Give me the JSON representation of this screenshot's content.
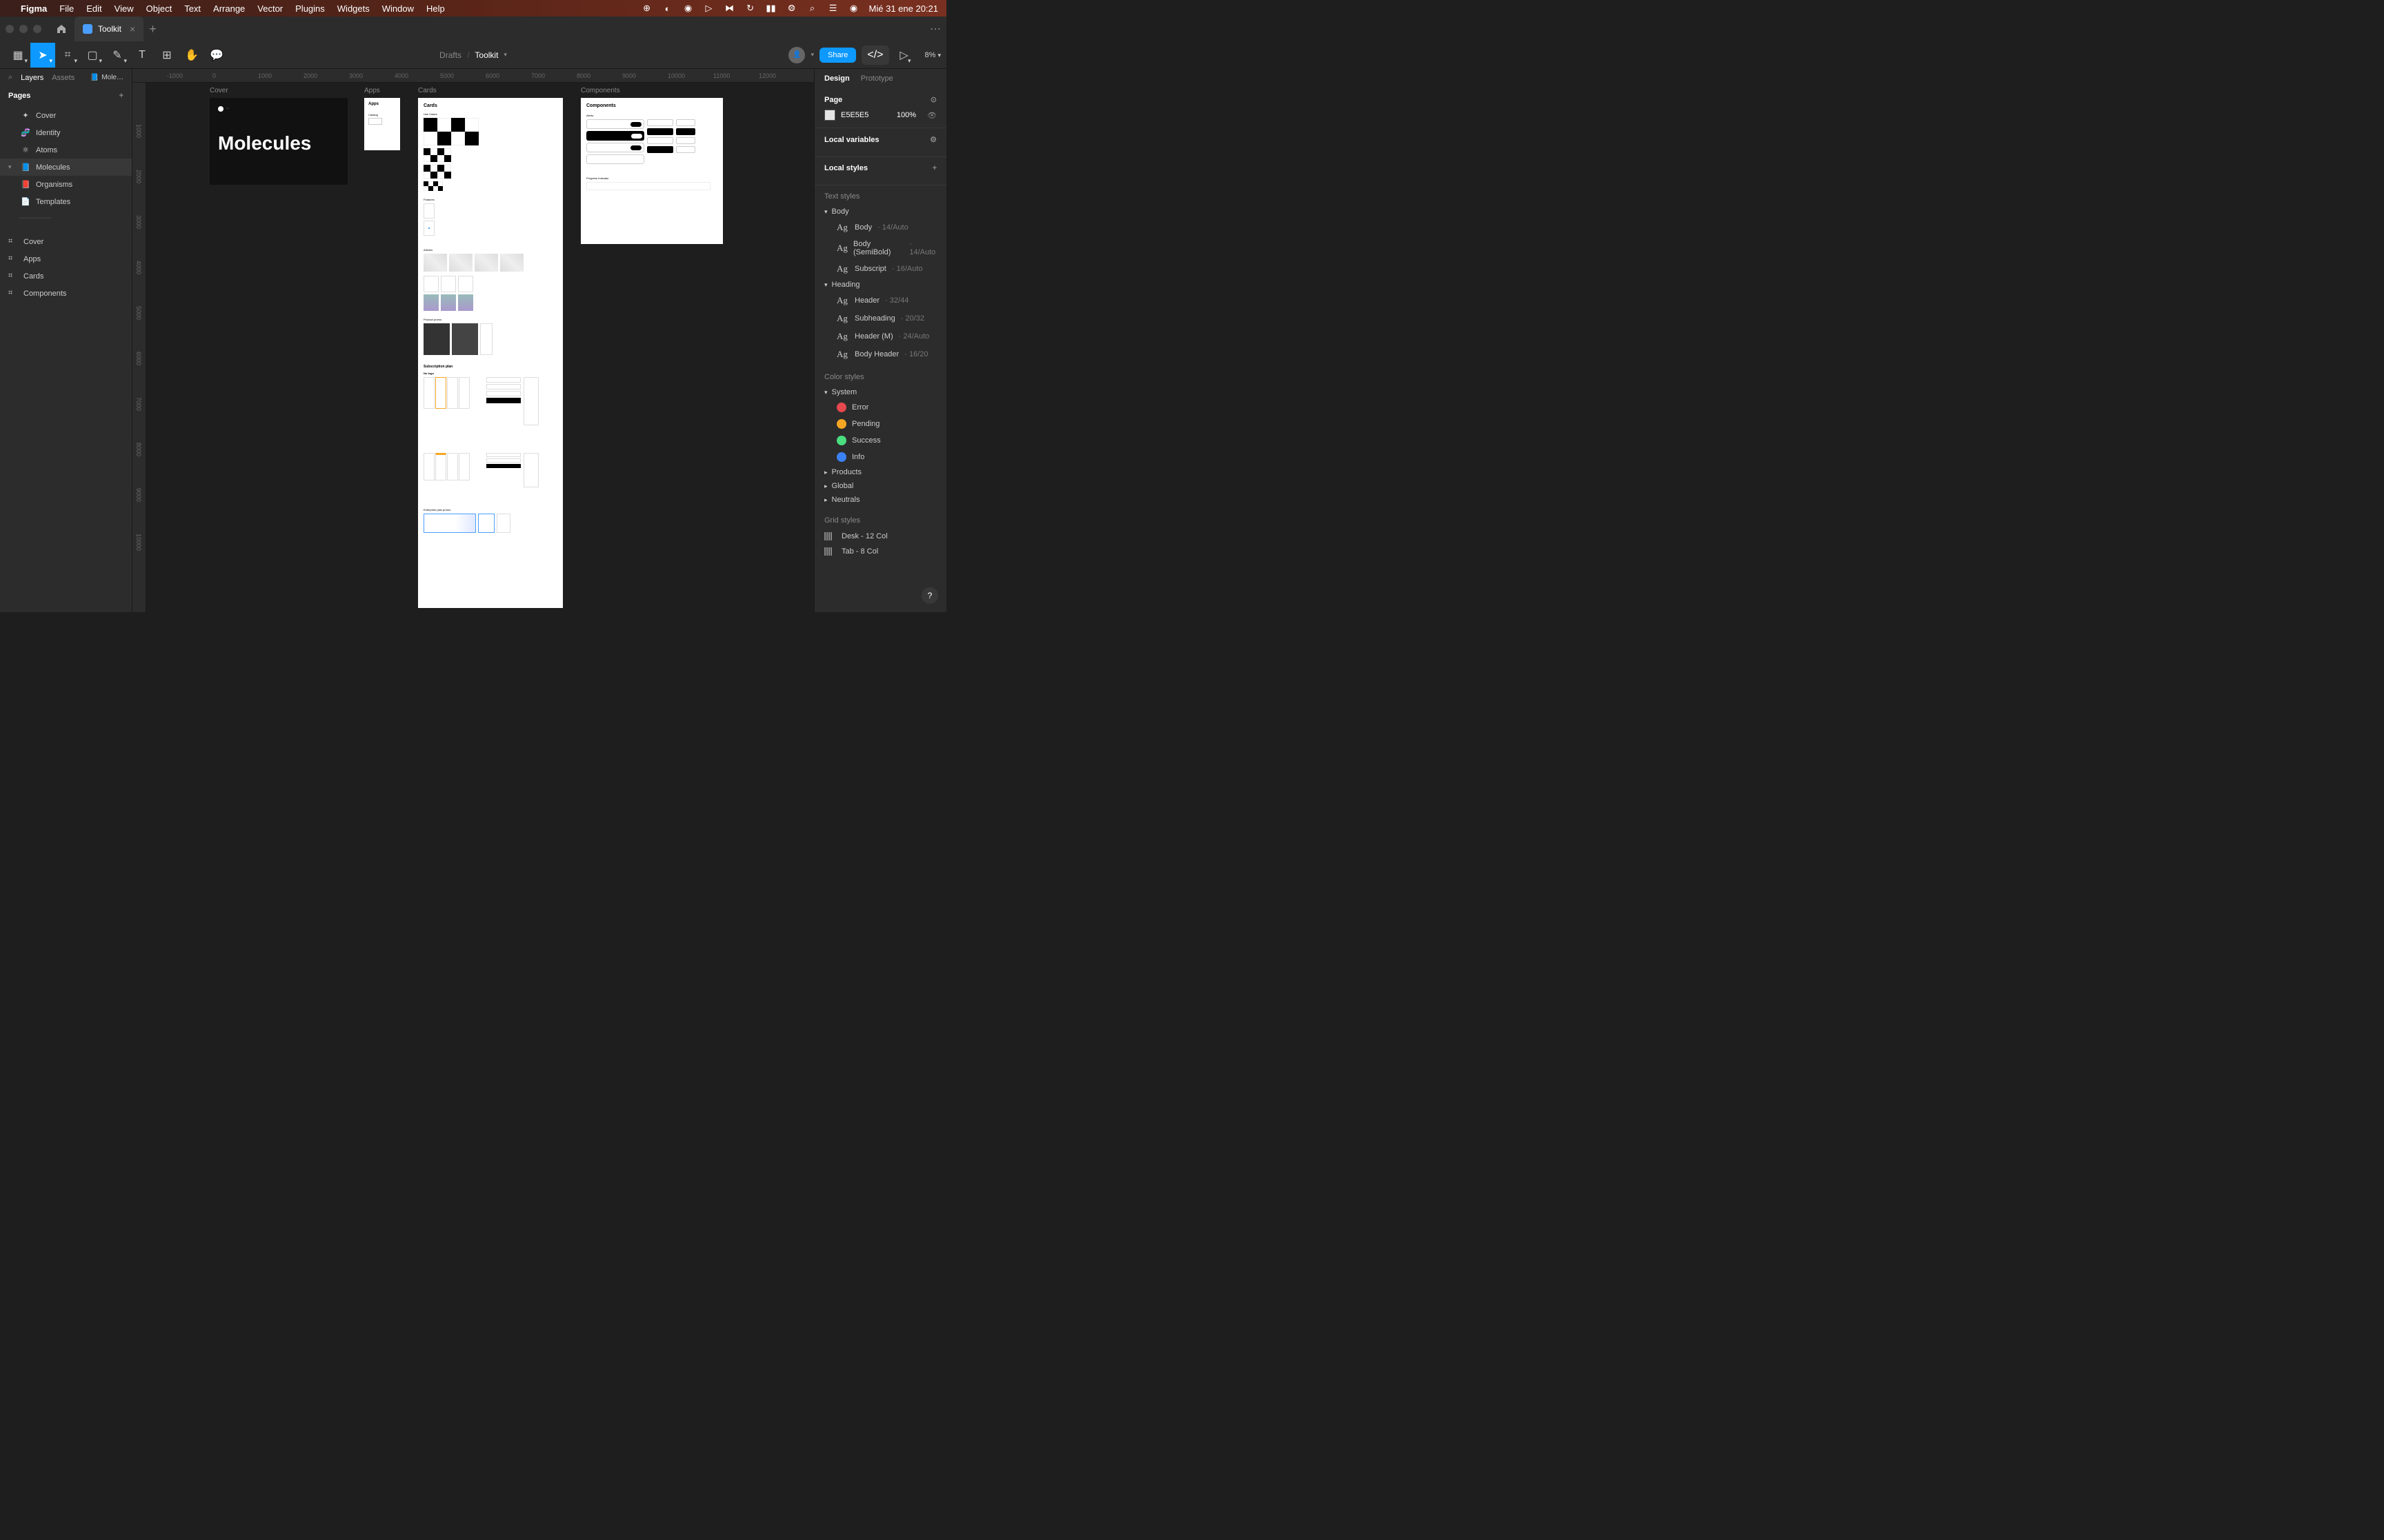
{
  "menubar": {
    "app": "Figma",
    "items": [
      "File",
      "Edit",
      "View",
      "Object",
      "Text",
      "Arrange",
      "Vector",
      "Plugins",
      "Widgets",
      "Window",
      "Help"
    ],
    "datetime": "Mié 31 ene 20:21"
  },
  "tab": {
    "title": "Toolkit"
  },
  "breadcrumb": {
    "drafts": "Drafts",
    "current": "Toolkit"
  },
  "toolbar_right": {
    "share": "Share",
    "zoom": "8%"
  },
  "left_panel": {
    "tabs": {
      "layers": "Layers",
      "assets": "Assets",
      "page_selector": "Mole…"
    },
    "pages_label": "Pages",
    "pages": [
      {
        "icon": "✦",
        "label": "Cover"
      },
      {
        "icon": "🧬",
        "label": "Identity"
      },
      {
        "icon": "⚛",
        "label": "Atoms"
      },
      {
        "icon": "📘",
        "label": "Molecules",
        "selected": true
      },
      {
        "icon": "📕",
        "label": "Organisms"
      },
      {
        "icon": "📄",
        "label": "Templates"
      }
    ],
    "frames": [
      {
        "label": "Cover"
      },
      {
        "label": "Apps"
      },
      {
        "label": "Cards"
      },
      {
        "label": "Components"
      }
    ]
  },
  "canvas": {
    "ruler_h": [
      "-1000",
      "0",
      "1000",
      "2000",
      "3000",
      "4000",
      "5000",
      "6000",
      "7000",
      "8000",
      "9000",
      "10000",
      "11000",
      "12000"
    ],
    "ruler_v": [
      "1000",
      "2000",
      "3000",
      "4000",
      "5000",
      "6000",
      "7000",
      "8000",
      "9000",
      "10000"
    ],
    "artboards": {
      "cover": {
        "label": "Cover",
        "title": "Molecules"
      },
      "apps": {
        "label": "Apps",
        "heading": "Apps"
      },
      "cards": {
        "label": "Cards",
        "heading": "Cards",
        "sections": [
          "Use Cases",
          "Features",
          "Articles",
          "Product promo",
          "Subscription plan",
          "No logo",
          "Enterprise plan promo"
        ]
      },
      "components": {
        "label": "Components",
        "heading": "Components",
        "sections": [
          "Alerts",
          "Progress Indicator"
        ]
      }
    }
  },
  "right_panel": {
    "tabs": {
      "design": "Design",
      "prototype": "Prototype"
    },
    "page_section": {
      "label": "Page",
      "color": "E5E5E5",
      "opacity": "100%"
    },
    "local_vars": "Local variables",
    "local_styles": "Local styles",
    "text_styles_label": "Text styles",
    "text_groups": [
      {
        "name": "Body",
        "items": [
          {
            "name": "Body",
            "detail": "14/Auto"
          },
          {
            "name": "Body (SemiBold)",
            "detail": "14/Auto"
          },
          {
            "name": "Subscript",
            "detail": "16/Auto"
          }
        ]
      },
      {
        "name": "Heading",
        "items": [
          {
            "name": "Header",
            "detail": "32/44"
          },
          {
            "name": "Subheading",
            "detail": "20/32"
          },
          {
            "name": "Header (M)",
            "detail": "24/Auto"
          },
          {
            "name": "Body Header",
            "detail": "16/20"
          }
        ]
      }
    ],
    "color_styles_label": "Color styles",
    "color_groups": [
      {
        "name": "System",
        "items": [
          {
            "name": "Error",
            "color": "#e5484d"
          },
          {
            "name": "Pending",
            "color": "#f5a623"
          },
          {
            "name": "Success",
            "color": "#4ade80"
          },
          {
            "name": "Info",
            "color": "#3b82f6"
          }
        ]
      },
      {
        "name": "Products",
        "items": []
      },
      {
        "name": "Global",
        "items": []
      },
      {
        "name": "Neutrals",
        "items": []
      }
    ],
    "grid_styles_label": "Grid styles",
    "grid_styles": [
      {
        "name": "Desk - 12 Col"
      },
      {
        "name": "Tab - 8 Col"
      }
    ]
  }
}
